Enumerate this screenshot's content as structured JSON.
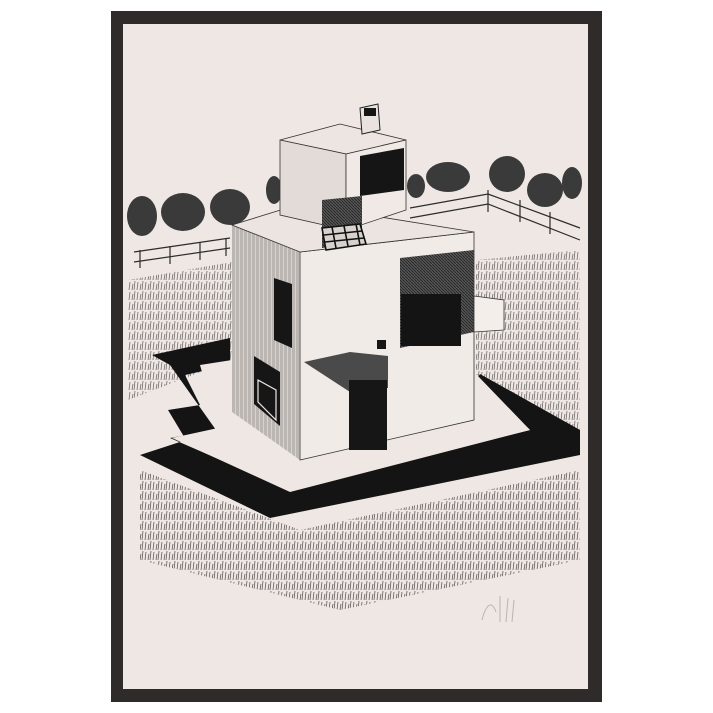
{
  "artwork": {
    "subject": "house-drawing",
    "frame_color": "#2e2b2a",
    "paper_color": "#efe7e3",
    "ink_color": "#111111",
    "signature_text": "Pan"
  }
}
